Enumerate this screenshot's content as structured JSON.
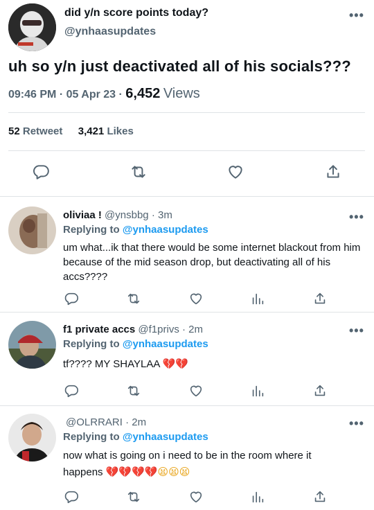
{
  "main_tweet": {
    "name": "did y/n score points today?",
    "handle": "@ynhaasupdates",
    "more_label": "•••",
    "text": "uh so y/n just deactivated all of his socials???",
    "time": "09:46 PM",
    "date": "05 Apr 23",
    "separator": "·",
    "views_count": "6,452",
    "views_label": "Views",
    "retweet_count": "52",
    "retweet_label": "Retweet",
    "likes_count": "3,421",
    "likes_label": "Likes"
  },
  "replies": [
    {
      "name": "oliviaa !",
      "handle": "@ynsbbg",
      "time": "· 3m",
      "replying_prefix": "Replying to",
      "replying_handle": "@ynhaasupdates",
      "text": "um what...ik that there would be some internet blackout from him because of the mid season drop, but deactivating all of his accs????"
    },
    {
      "name": "f1 private accs",
      "handle": "@f1privs",
      "time": "· 2m",
      "replying_prefix": "Replying to",
      "replying_handle": "@ynhaasupdates",
      "text": "tf???? MY SHAYLAA",
      "emoji": "💔💔"
    },
    {
      "name": "",
      "handle": "@OLRRARI",
      "time": "· 2m",
      "replying_prefix": "Replying to",
      "replying_handle": "@ynhaasupdates",
      "text_line1": "now what is going on i need to be in the room where it",
      "text_line2": "happens",
      "emoji_hearts": "💔💔💔💔",
      "emoji_faces": "😫😫😫"
    }
  ],
  "icons": {
    "reply": "reply-bubble-icon",
    "retweet": "retweet-icon",
    "like": "heart-icon",
    "analytics": "analytics-icon",
    "share": "share-icon",
    "more": "more-dots-icon"
  },
  "colors": {
    "text": "#0f1419",
    "secondary": "#536471",
    "link": "#1d9bf0",
    "divider": "#dfe3e6"
  }
}
